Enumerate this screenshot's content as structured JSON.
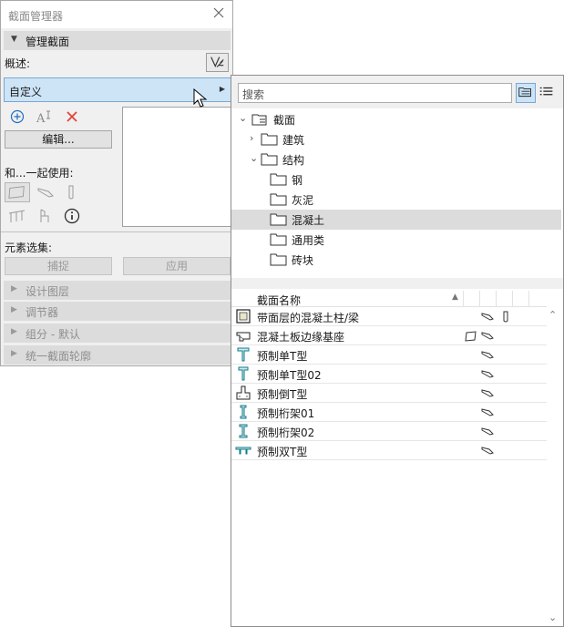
{
  "palette": {
    "title": "截面管理器",
    "section_header": "管理截面",
    "description_label": "概述:",
    "combo_value": "自定义",
    "edit_button": "编辑...",
    "use_with_label": "和...一起使用:",
    "element_set_label": "元素选集:",
    "capture_button": "捕捉",
    "apply_button": "应用",
    "collapsed_sections": [
      "设计图层",
      "调节器",
      "组分 - 默认",
      "统一截面轮廓"
    ]
  },
  "popup": {
    "search_placeholder": "搜索",
    "tree": {
      "root": "截面",
      "building": "建筑",
      "structure": "结构",
      "children": [
        "钢",
        "灰泥",
        "混凝土",
        "通用类",
        "砖块"
      ],
      "selected": "混凝土"
    },
    "list": {
      "header": "截面名称",
      "rows": [
        "带面层的混凝土柱/梁",
        "混凝土板边缘基座",
        "预制单T型",
        "预制单T型02",
        "预制倒T型",
        "预制桁架01",
        "预制桁架02",
        "预制双T型"
      ]
    }
  },
  "colors": {
    "accent": "#1f6fbf",
    "selection": "#cde4f7",
    "delete": "#e0453a",
    "profile_icon": "#117a8b"
  }
}
